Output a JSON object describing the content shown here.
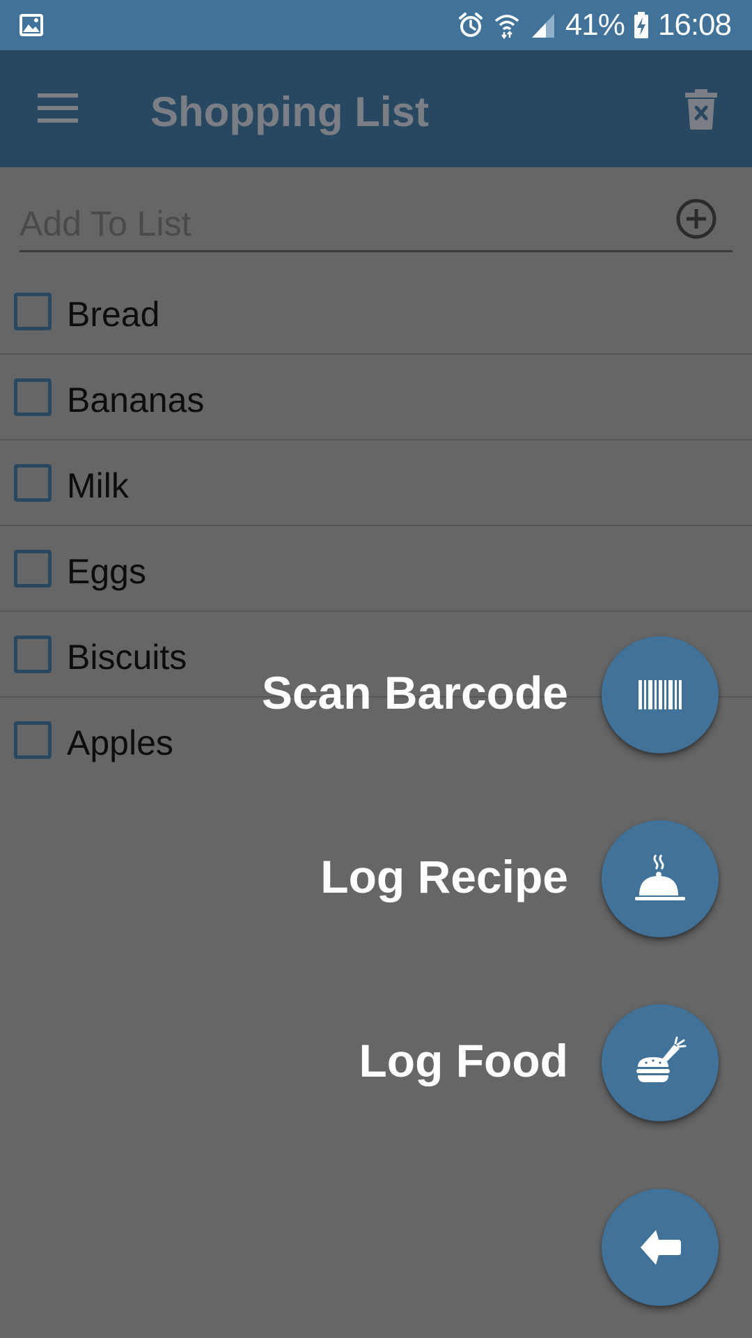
{
  "status_bar": {
    "battery": "41%",
    "time": "16:08",
    "icons": [
      "gallery-icon",
      "alarm-icon",
      "wifi-icon",
      "signal-icon",
      "battery-charging-icon"
    ]
  },
  "app_bar": {
    "title": "Shopping List",
    "menu_icon": "hamburger-menu-icon",
    "action_icon": "delete-list-icon"
  },
  "add_to_list": {
    "placeholder": "Add To List",
    "value": "",
    "add_icon": "add-circle-icon"
  },
  "items": [
    {
      "label": "Bread",
      "checked": false
    },
    {
      "label": "Bananas",
      "checked": false
    },
    {
      "label": "Milk",
      "checked": false
    },
    {
      "label": "Eggs",
      "checked": false
    },
    {
      "label": "Biscuits",
      "checked": false
    },
    {
      "label": "Apples",
      "checked": false
    }
  ],
  "fab_menu": {
    "actions": [
      {
        "label": "Scan Barcode",
        "icon": "barcode-icon"
      },
      {
        "label": "Log Recipe",
        "icon": "cloche-icon"
      },
      {
        "label": "Log Food",
        "icon": "food-icon"
      }
    ],
    "main_icon": "back-arrow-icon"
  },
  "colors": {
    "status_bar": "#41729A",
    "app_bar": "#284862",
    "overlay_background": "#666666",
    "fab": "#41729A"
  }
}
